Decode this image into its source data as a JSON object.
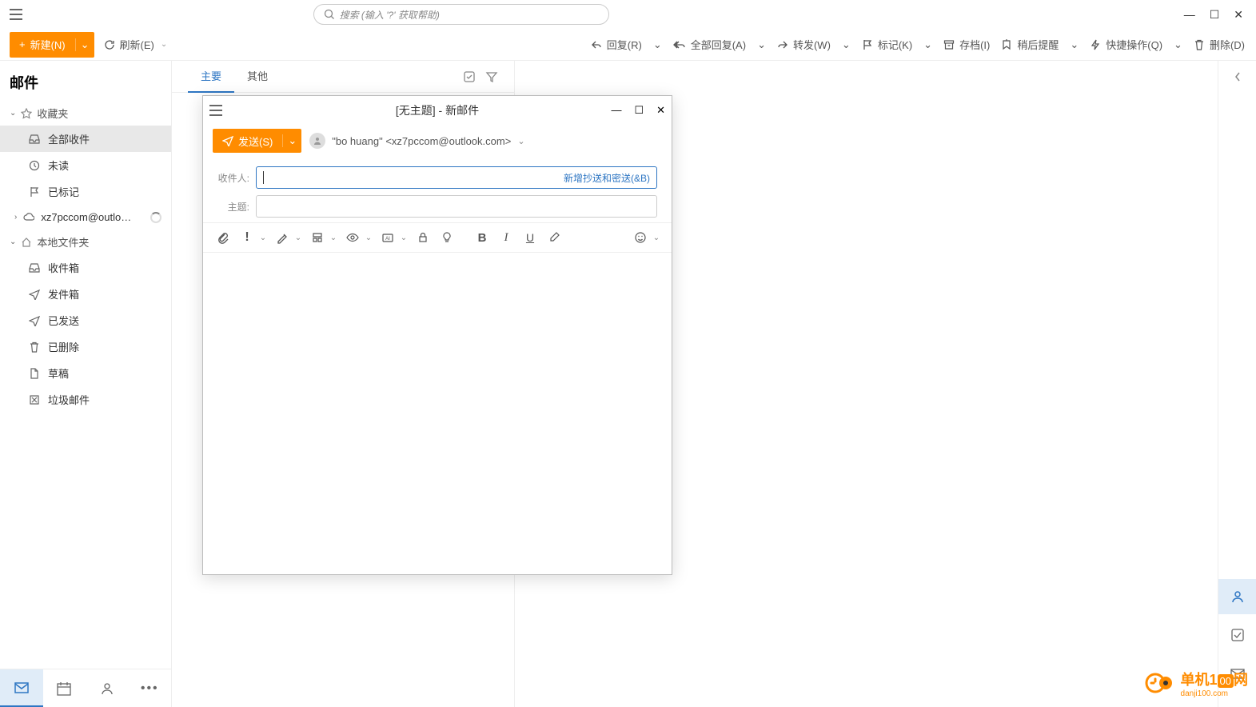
{
  "search": {
    "placeholder": "搜索 (输入 '?' 获取帮助)"
  },
  "toolbar": {
    "new": "新建(N)",
    "refresh": "刷新(E)",
    "reply": "回复(R)",
    "reply_all": "全部回复(A)",
    "forward": "转发(W)",
    "mark": "标记(K)",
    "archive": "存档(I)",
    "remind": "稍后提醒",
    "quick": "快捷操作(Q)",
    "delete": "删除(D)"
  },
  "sidebar": {
    "title": "邮件",
    "favorites": {
      "label": "收藏夹"
    },
    "items_fav": [
      {
        "label": "全部收件"
      },
      {
        "label": "未读"
      },
      {
        "label": "已标记"
      }
    ],
    "account": "xz7pccom@outlook.c...",
    "local_label": "本地文件夹",
    "items_local": [
      {
        "label": "收件箱"
      },
      {
        "label": "发件箱"
      },
      {
        "label": "已发送"
      },
      {
        "label": "已删除"
      },
      {
        "label": "草稿"
      },
      {
        "label": "垃圾邮件"
      }
    ]
  },
  "tabs": {
    "main": "主要",
    "other": "其他"
  },
  "compose": {
    "title": "[无主题] - 新邮件",
    "send": "发送(S)",
    "sender": "\"bo huang\" <xz7pccom@outlook.com>",
    "to_label": "收件人:",
    "cc_link": "新增抄送和密送(&B)",
    "subject_label": "主题:"
  },
  "watermark": {
    "main": "单机1",
    "suffix": "网",
    "sub": "danji100.com"
  }
}
